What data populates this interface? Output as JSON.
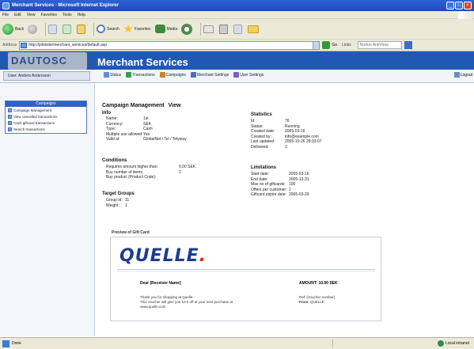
{
  "window": {
    "title": "Merchant Services - Microsoft Internet Explorer"
  },
  "menu": [
    "File",
    "Edit",
    "View",
    "Favorites",
    "Tools",
    "Help"
  ],
  "toolbar": {
    "back": "Back",
    "search": "Search",
    "favorites": "Favorites",
    "media": "Media"
  },
  "address": {
    "label": "Address",
    "url": "http://pilotsite/merchant_services/default.asp",
    "go": "Go",
    "links": "Links",
    "norton": "Norton AntiVirus"
  },
  "app": {
    "logo": "DAUTOSC",
    "title": "Merchant Services",
    "user": "User: Anders Andersson",
    "nav": [
      {
        "label": "Status",
        "icon": "status-icon"
      },
      {
        "label": "Transactions",
        "icon": "transactions-icon"
      },
      {
        "label": "Campaigns",
        "icon": "campaigns-icon"
      },
      {
        "label": "Merchant Settings",
        "icon": "merchant-settings-icon"
      },
      {
        "label": "User Settings",
        "icon": "user-settings-icon"
      }
    ],
    "logout": "Logout"
  },
  "sidebar": {
    "header": "Campaigns",
    "items": [
      "Campaign Management",
      "View cancelled transactions",
      "Cash giftcard transactions",
      "Search transactions"
    ]
  },
  "main": {
    "heading": "Campaign Management",
    "heading_view": "View",
    "info": {
      "title": "Info",
      "rows": [
        {
          "k": "Name:",
          "v": "1st"
        },
        {
          "k": "Currency:",
          "v": "SEK"
        },
        {
          "k": "Type:",
          "v": "Cash"
        },
        {
          "k": "Multiple use allowed:",
          "v": "Yes"
        },
        {
          "k": "Valid at:",
          "v": "GlobalNet / Tel / Telyway"
        }
      ]
    },
    "statistics": {
      "title": "Statistics",
      "rows": [
        {
          "k": "Id:",
          "v": "76"
        },
        {
          "k": "Status:",
          "v": "Running"
        },
        {
          "k": "Created date:",
          "v": "2005-03-16"
        },
        {
          "k": "Created by:",
          "v": "info@example.com"
        },
        {
          "k": "Last updated:",
          "v": "2005-10-26 28:33:07"
        },
        {
          "k": "Delivered:",
          "v": "1"
        }
      ]
    },
    "conditions": {
      "title": "Conditions",
      "rows": [
        {
          "k": "Requires amount higher than:",
          "v": "0.00 SEK"
        },
        {
          "k": "Buy number of items:",
          "v": "1"
        },
        {
          "k": "Buy product (Product Code):",
          "v": ""
        }
      ]
    },
    "limitations": {
      "title": "Limitations",
      "rows": [
        {
          "k": "Start date:",
          "v": "2005-03-16"
        },
        {
          "k": "End date:",
          "v": "2005-12-31"
        },
        {
          "k": "Max no of giftcards:",
          "v": "100"
        },
        {
          "k": "Offers per customer:",
          "v": "1"
        },
        {
          "k": "Giftcard expire date:",
          "v": "2005-03-29"
        }
      ]
    },
    "target": {
      "title": "Target Groups",
      "rows": [
        {
          "k": "Group Id:",
          "v": "11"
        },
        {
          "k": "Weight:",
          "v": "1"
        }
      ]
    },
    "preview": {
      "title": "Preview of Gift Card",
      "brand": "QUELLE",
      "brand_dot": ".",
      "dear": "Dear [Receiver Name]",
      "amount": "AMOUNT: 10.00 SEK",
      "message_lines": [
        "Thank you for shopping at Quelle.",
        "This voucher will give you 10 € off at your next purchase at",
        "www.quelle.com"
      ],
      "voucher_lines": [
        "Ref: [Voucher number]"
      ],
      "from_label": "From:",
      "from_value": "QUELLE"
    }
  },
  "status": {
    "left": "Done",
    "zone": "Local intranet"
  }
}
